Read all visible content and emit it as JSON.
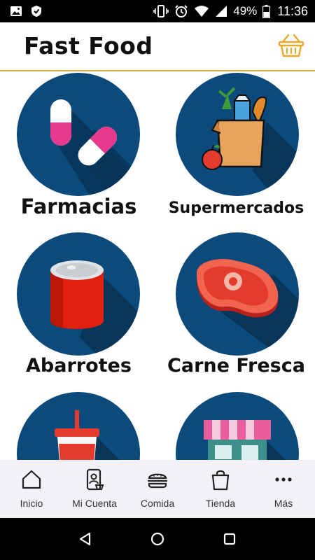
{
  "status_bar": {
    "battery_percent": "49%",
    "time": "11:36",
    "icons": [
      "image-icon",
      "shield-icon",
      "vibrate-icon",
      "alarm-icon",
      "wifi-icon",
      "signal-icon",
      "battery-icon"
    ]
  },
  "header": {
    "title": "Fast Food",
    "cart_icon": "basket-icon",
    "accent_color": "#d8a73c"
  },
  "categories": [
    {
      "label": "Farmacias",
      "icon": "pills-icon"
    },
    {
      "label": "Supermercados",
      "icon": "grocery-bag-icon"
    },
    {
      "label": "Abarrotes",
      "icon": "can-icon"
    },
    {
      "label": "Carne Fresca",
      "icon": "steak-icon"
    },
    {
      "label": "",
      "icon": "drink-cup-icon"
    },
    {
      "label": "",
      "icon": "store-icon"
    }
  ],
  "circle_color": "#0b4a7a",
  "bottom_nav": [
    {
      "label": "Inicio",
      "icon": "home-icon"
    },
    {
      "label": "Mi Cuenta",
      "icon": "account-phone-icon"
    },
    {
      "label": "Comida",
      "icon": "burger-icon"
    },
    {
      "label": "Tienda",
      "icon": "shopping-bag-icon"
    },
    {
      "label": "Más",
      "icon": "more-dots-icon"
    }
  ],
  "system_nav": [
    "back-icon",
    "home-circle-icon",
    "recents-icon"
  ]
}
